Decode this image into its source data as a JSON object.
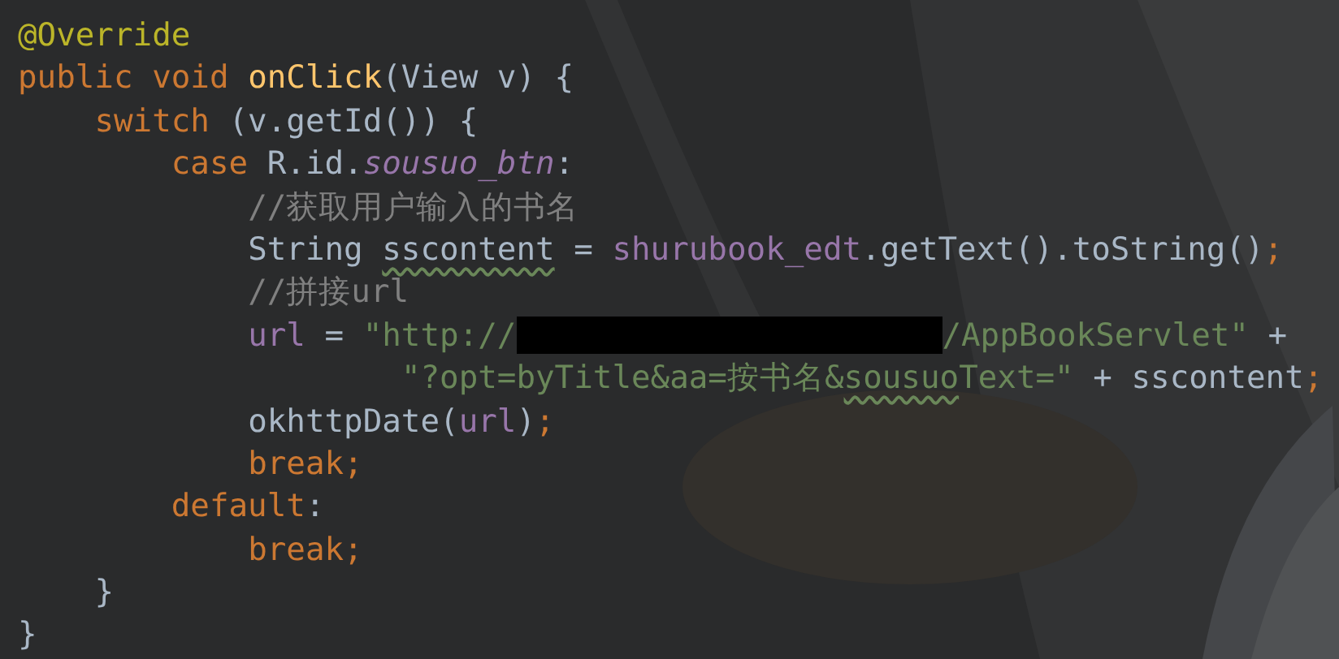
{
  "code_lines": [
    {
      "tokens": [
        {
          "kind": "annotation",
          "text": "@Override"
        }
      ]
    },
    {
      "tokens": [
        {
          "kind": "keyword",
          "text": "public void "
        },
        {
          "kind": "method",
          "text": "onClick"
        },
        {
          "kind": "plain",
          "text": "(View v) {"
        }
      ]
    },
    {
      "tokens": [
        {
          "kind": "keyword",
          "text": "    switch "
        },
        {
          "kind": "plain",
          "text": "(v.getId()) {"
        }
      ]
    },
    {
      "tokens": [
        {
          "kind": "keyword",
          "text": "        case "
        },
        {
          "kind": "plain",
          "text": "R.id."
        },
        {
          "kind": "static",
          "text": "sousuo_btn"
        },
        {
          "kind": "plain",
          "text": ":"
        }
      ]
    },
    {
      "tokens": [
        {
          "kind": "comment",
          "text": "            //获取用户输入的书名"
        }
      ]
    },
    {
      "tokens": [
        {
          "kind": "plain",
          "text": "            String "
        },
        {
          "kind": "plain",
          "text": "sscontent",
          "typo": true
        },
        {
          "kind": "plain",
          "text": " = "
        },
        {
          "kind": "field",
          "text": "shurubook_edt"
        },
        {
          "kind": "plain",
          "text": ".getText().toString()"
        },
        {
          "kind": "keyword",
          "text": ";"
        }
      ]
    },
    {
      "tokens": [
        {
          "kind": "comment",
          "text": "            //拼接url"
        }
      ]
    },
    {
      "tokens": [
        {
          "kind": "field",
          "text": "            url"
        },
        {
          "kind": "plain",
          "text": " = "
        },
        {
          "kind": "string",
          "text": "\"http://"
        },
        {
          "kind": "redacted"
        },
        {
          "kind": "string",
          "text": "/AppBookServlet\""
        },
        {
          "kind": "plain",
          "text": " +"
        }
      ]
    },
    {
      "tokens": [
        {
          "kind": "string",
          "text": "                    \"?opt=byTitle&aa=按书名&"
        },
        {
          "kind": "string",
          "text": "sousuo",
          "typo": true
        },
        {
          "kind": "string",
          "text": "Text=\""
        },
        {
          "kind": "plain",
          "text": " + sscontent"
        },
        {
          "kind": "keyword",
          "text": ";"
        }
      ]
    },
    {
      "tokens": [
        {
          "kind": "plain",
          "text": "            okhttpDate("
        },
        {
          "kind": "field",
          "text": "url"
        },
        {
          "kind": "plain",
          "text": ")"
        },
        {
          "kind": "keyword",
          "text": ";"
        }
      ]
    },
    {
      "tokens": [
        {
          "kind": "keyword",
          "text": "            break;"
        }
      ]
    },
    {
      "tokens": [
        {
          "kind": "keyword",
          "text": "        default"
        },
        {
          "kind": "plain",
          "text": ":"
        }
      ]
    },
    {
      "tokens": [
        {
          "kind": "keyword",
          "text": "            break;"
        }
      ]
    },
    {
      "tokens": [
        {
          "kind": "plain",
          "text": "    }"
        }
      ]
    },
    {
      "tokens": [
        {
          "kind": "plain",
          "text": "}"
        }
      ]
    }
  ]
}
